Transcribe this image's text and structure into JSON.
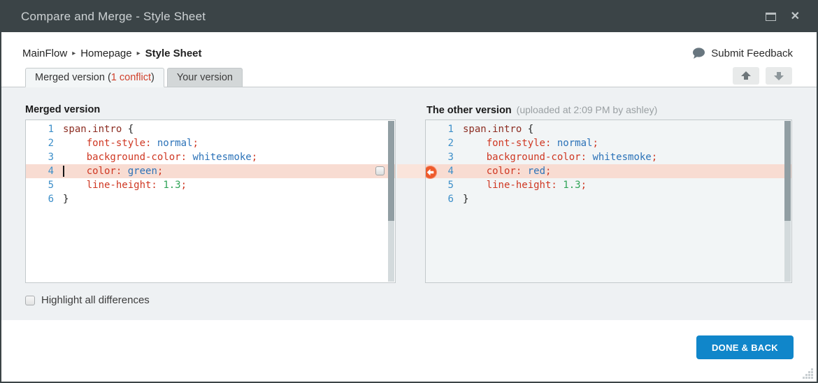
{
  "window": {
    "title": "Compare and Merge - Style Sheet"
  },
  "breadcrumb": {
    "items": [
      "MainFlow",
      "Homepage",
      "Style Sheet"
    ],
    "separator": "▸"
  },
  "feedback": {
    "label": "Submit Feedback"
  },
  "tabs": {
    "merged": {
      "prefix": "Merged version (",
      "conflict": "1 conflict",
      "suffix": ")"
    },
    "yours": {
      "label": "Your version"
    }
  },
  "panels": {
    "left": {
      "heading": "Merged version",
      "scroll_thumb_pct": 62,
      "lines": [
        {
          "num": 1,
          "tokens": [
            [
              "sel",
              "span.intro"
            ],
            [
              "plain",
              " {"
            ]
          ]
        },
        {
          "num": 2,
          "tokens": [
            [
              "plain",
              "    "
            ],
            [
              "prop",
              "font-style:"
            ],
            [
              "plain",
              " "
            ],
            [
              "val",
              "normal"
            ],
            [
              "prop",
              ";"
            ]
          ]
        },
        {
          "num": 3,
          "tokens": [
            [
              "plain",
              "    "
            ],
            [
              "prop",
              "background-color:"
            ],
            [
              "plain",
              " "
            ],
            [
              "val",
              "whitesmoke"
            ],
            [
              "prop",
              ";"
            ]
          ]
        },
        {
          "num": 4,
          "highlight": true,
          "cursor": true,
          "checkbox": true,
          "tokens": [
            [
              "plain",
              "    "
            ],
            [
              "prop",
              "color:"
            ],
            [
              "plain",
              " "
            ],
            [
              "val",
              "green"
            ],
            [
              "prop",
              ";"
            ]
          ]
        },
        {
          "num": 5,
          "tokens": [
            [
              "plain",
              "    "
            ],
            [
              "prop",
              "line-height:"
            ],
            [
              "plain",
              " "
            ],
            [
              "num",
              "1.3"
            ],
            [
              "prop",
              ";"
            ]
          ]
        },
        {
          "num": 6,
          "tokens": [
            [
              "plain",
              "}"
            ]
          ]
        }
      ]
    },
    "right": {
      "heading": "The other version",
      "subtitle": "(uploaded at 2:09 PM by ashley)",
      "scroll_thumb_pct": 62,
      "lines": [
        {
          "num": 1,
          "tokens": [
            [
              "sel",
              "span.intro"
            ],
            [
              "plain",
              " {"
            ]
          ]
        },
        {
          "num": 2,
          "tokens": [
            [
              "plain",
              "    "
            ],
            [
              "prop",
              "font-style:"
            ],
            [
              "plain",
              " "
            ],
            [
              "val",
              "normal"
            ],
            [
              "prop",
              ";"
            ]
          ]
        },
        {
          "num": 3,
          "tokens": [
            [
              "plain",
              "    "
            ],
            [
              "prop",
              "background-color:"
            ],
            [
              "plain",
              " "
            ],
            [
              "val",
              "whitesmoke"
            ],
            [
              "prop",
              ";"
            ]
          ]
        },
        {
          "num": 4,
          "highlight": true,
          "tokens": [
            [
              "plain",
              "    "
            ],
            [
              "prop",
              "color:"
            ],
            [
              "plain",
              " "
            ],
            [
              "val",
              "red"
            ],
            [
              "prop",
              ";"
            ]
          ]
        },
        {
          "num": 5,
          "tokens": [
            [
              "plain",
              "    "
            ],
            [
              "prop",
              "line-height:"
            ],
            [
              "plain",
              " "
            ],
            [
              "num",
              "1.3"
            ],
            [
              "prop",
              ";"
            ]
          ]
        },
        {
          "num": 6,
          "tokens": [
            [
              "plain",
              "}"
            ]
          ]
        }
      ]
    }
  },
  "controls": {
    "highlight_label": "Highlight all differences"
  },
  "footer": {
    "done_button": "DONE & BACK"
  },
  "icons": {
    "close": "✕",
    "maximize": "maximize-square",
    "feedback_bubble": "speech-bubble",
    "prev": "up-arrow",
    "next": "down-arrow",
    "merge": "left-arrow"
  },
  "colors": {
    "accent_blue": "#1086ca",
    "conflict_red": "#d0402b",
    "highlight_salmon": "#f8dcd2",
    "merge_orange": "#ee5a2b",
    "titlebar": "#3b4447"
  }
}
